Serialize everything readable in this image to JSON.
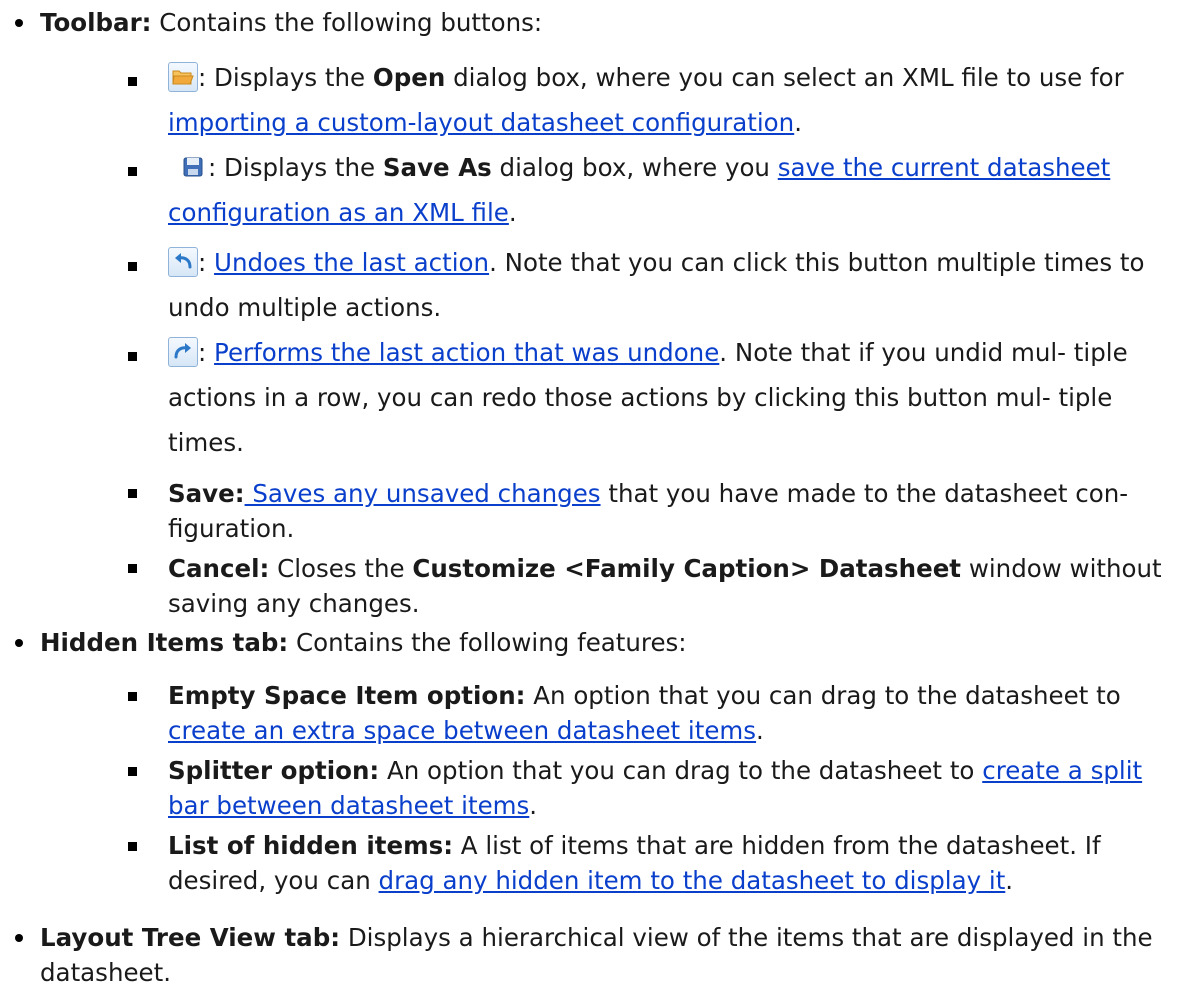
{
  "toolbar": {
    "label": "Toolbar:",
    "desc": " Contains the following buttons:",
    "items": {
      "open": {
        "icon": "open-folder-icon",
        "pre": ": Displays the ",
        "bold": "Open",
        "mid": " dialog box, where you can select an XML file to use for ",
        "link": "importing a custom-layout datasheet configuration",
        "post": "."
      },
      "save_as": {
        "icon": "save-disk-icon",
        "pre": ": Displays the ",
        "bold": "Save As",
        "mid": " dialog box, where you ",
        "link": "save the current datasheet configuration as an XML file",
        "post": "."
      },
      "undo": {
        "icon": "undo-arrow-icon",
        "pre": ": ",
        "link": "Undoes the last action",
        "post": ". Note that you can click this button multiple times to undo multiple actions."
      },
      "redo": {
        "icon": "redo-arrow-icon",
        "pre": ": ",
        "link": "Performs the last action that was undone",
        "post": ". Note that if you undid mul- tiple actions in a row, you can redo those actions by clicking this button mul- tiple times."
      },
      "save": {
        "label": "Save:",
        "link": " Saves any unsaved changes",
        "post": " that you have made to the datasheet con- figuration."
      },
      "cancel": {
        "label": "Cancel:",
        "pre": " Closes the ",
        "bold": "Customize <Family Caption> Datasheet",
        "post": " window without saving any changes."
      }
    }
  },
  "hidden_items": {
    "label": "Hidden Items tab:",
    "desc": " Contains the following features:",
    "items": {
      "empty_space": {
        "label": "Empty Space Item option:",
        "pre": " An option that you can drag to the datasheet to ",
        "link": "create an extra space between datasheet items",
        "post": "."
      },
      "splitter": {
        "label": "Splitter option:",
        "pre": " An option that you can drag to the datasheet to ",
        "link": "create a split bar between datasheet items",
        "post": "."
      },
      "list": {
        "label": "List of hidden items:",
        "pre": " A list of items that are hidden from the datasheet. If desired, you can ",
        "link": "drag any hidden item to the datasheet to display it",
        "post": "."
      }
    }
  },
  "layout_tree": {
    "label": "Layout Tree View tab:",
    "desc": " Displays a hierarchical view of the items that are displayed in the datasheet."
  },
  "colors": {
    "link": "#0a3fcc",
    "text": "#1a1a1a",
    "icon_border": "#8fb3d9",
    "folder": "#f2a93b",
    "disk": "#3f6fb8",
    "arrow": "#2b78c9"
  }
}
